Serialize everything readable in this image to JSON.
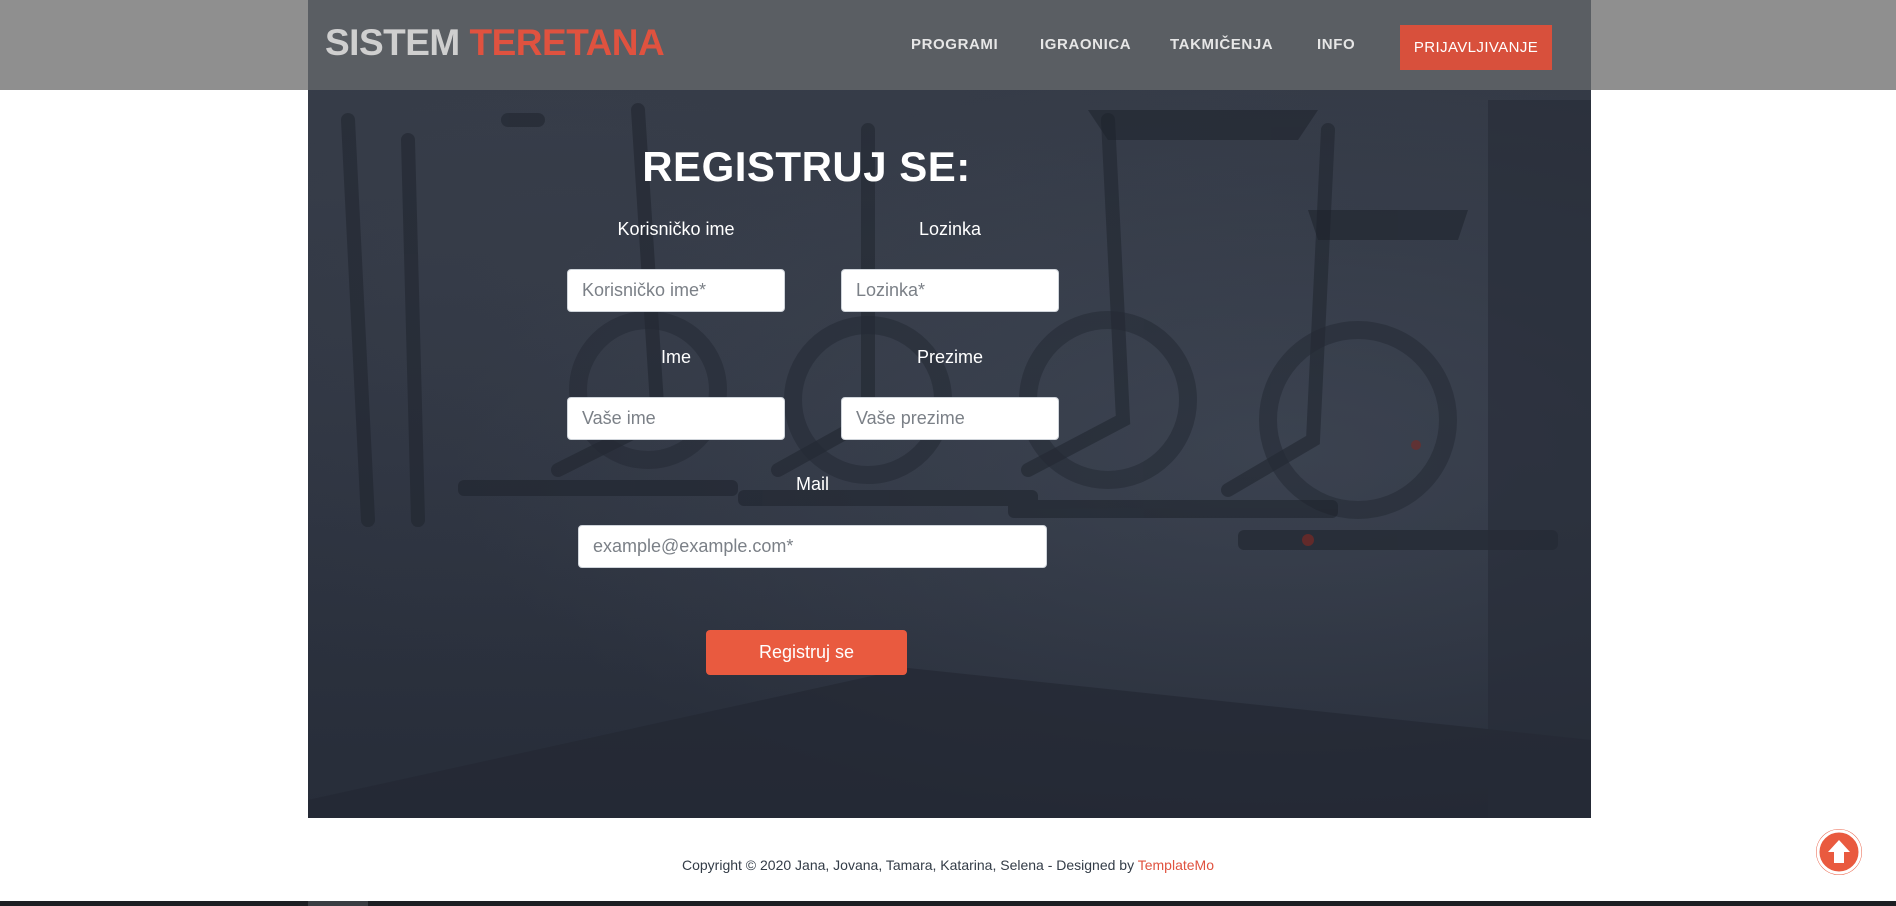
{
  "brand": {
    "part1": "SISTEM",
    "part2": "TERETANA"
  },
  "nav": {
    "items": [
      {
        "label": "PROGRAMI"
      },
      {
        "label": "IGRAONICA"
      },
      {
        "label": "TAKMIČENJA"
      },
      {
        "label": "INFO"
      }
    ],
    "login_label": "PRIJAVLJIVANJE"
  },
  "form": {
    "title": "REGISTRUJ SE:",
    "username": {
      "label": "Korisničko ime",
      "placeholder": "Korisničko ime*"
    },
    "password": {
      "label": "Lozinka",
      "placeholder": "Lozinka*"
    },
    "first_name": {
      "label": "Ime",
      "placeholder": "Vaše ime"
    },
    "last_name": {
      "label": "Prezime",
      "placeholder": "Vaše prezime"
    },
    "email": {
      "label": "Mail",
      "placeholder": "example@example.com*"
    },
    "submit_label": "Registruj se"
  },
  "footer": {
    "text": "Copyright © 2020 Jana, Jovana, Tamara, Katarina, Selena - Designed by ",
    "link": "TemplateMo"
  },
  "colors": {
    "accent": "#e95a3f",
    "hero_bg": "#2e3441",
    "nav_bg": "#585c62"
  },
  "icons": {
    "scroll_top": "arrow-up-circle-icon"
  }
}
